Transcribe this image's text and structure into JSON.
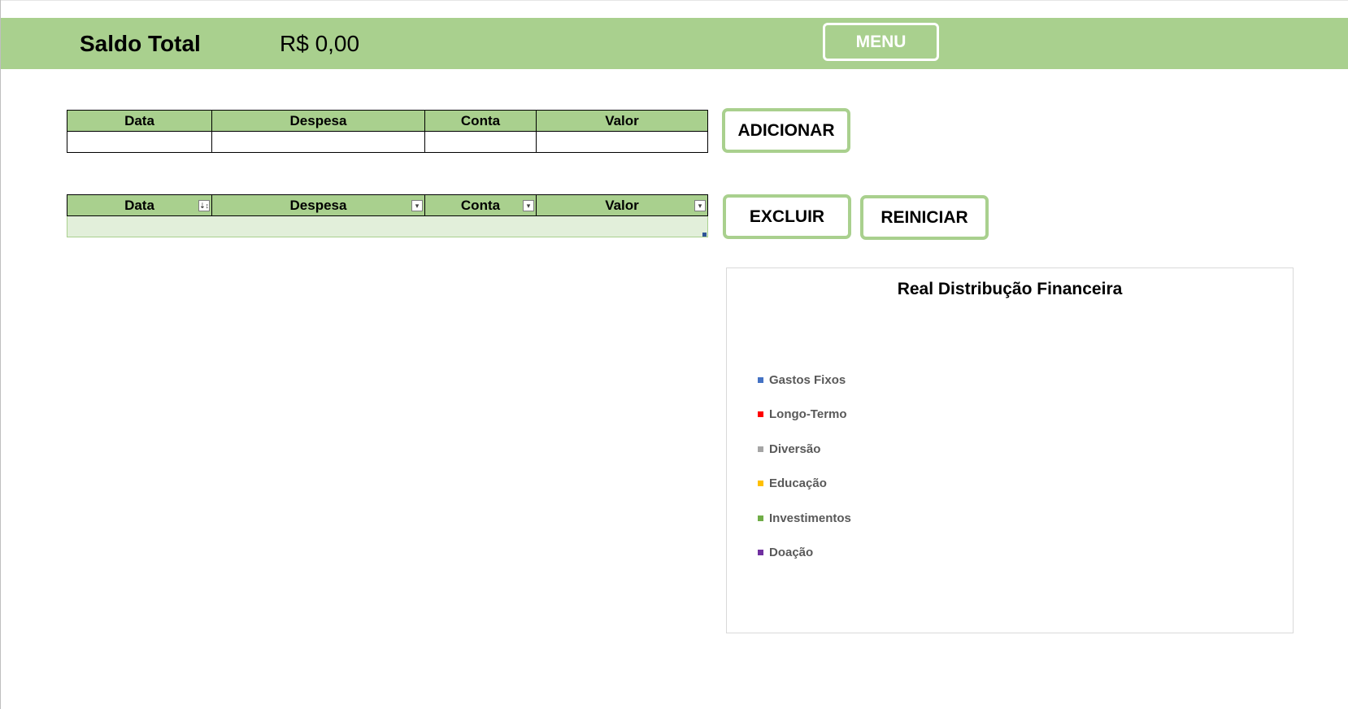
{
  "header": {
    "saldo_label": "Saldo Total",
    "saldo_value": "R$ 0,00",
    "menu_label": "MENU",
    "band_color": "#a9d08e"
  },
  "input_table": {
    "columns": [
      "Data",
      "Despesa",
      "Conta",
      "Valor"
    ]
  },
  "list_table": {
    "columns": [
      "Data",
      "Despesa",
      "Conta",
      "Valor"
    ],
    "filter_glyphs": [
      "⇣↕",
      "▾",
      "▾",
      "▾"
    ]
  },
  "buttons": {
    "adicionar": "ADICIONAR",
    "excluir": "EXCLUIR",
    "reiniciar": "REINICIAR",
    "border_color": "#a9d08e"
  },
  "chart_data": {
    "type": "pie",
    "title": "Real Distribução Financeira",
    "categories": [
      "Gastos Fixos",
      "Longo-Termo",
      "Diversão",
      "Educação",
      "Investimentos",
      "Doação"
    ],
    "values": [
      0,
      0,
      0,
      0,
      0,
      0
    ],
    "colors": [
      "#4472c4",
      "#ff0000",
      "#a5a5a5",
      "#ffc000",
      "#70ad47",
      "#7030a0"
    ],
    "legend_position": "left"
  }
}
